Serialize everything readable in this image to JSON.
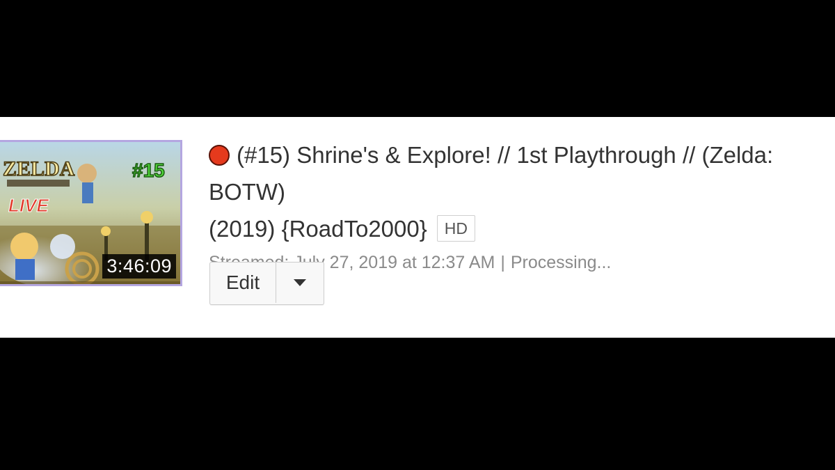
{
  "video": {
    "title_line1": "(#15) Shrine's & Explore! // 1st Playthrough // (Zelda: BOTW)",
    "title_line2": "(2019) {RoadTo2000}",
    "quality_badge": "HD",
    "streamed": "Streamed: July 27, 2019 at 12:37 AM",
    "separator": "|",
    "status": "Processing...",
    "duration": "3:46:09",
    "live_indicator_color": "#e53a1d"
  },
  "thumbnail": {
    "logo_text": "ZELDA",
    "live_text": "LIVE",
    "episode_text": "#15"
  },
  "actions": {
    "edit_label": "Edit",
    "dropdown_icon": "caret-down-icon"
  }
}
